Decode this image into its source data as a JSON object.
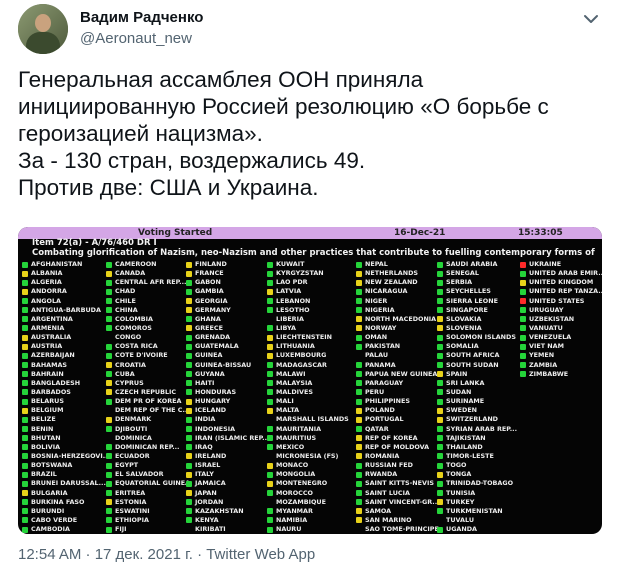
{
  "author": {
    "name": "Вадим Радченко",
    "handle": "@Aeronaut_new"
  },
  "tweet_lines": [
    "Генеральная ассамблея ООН приняла",
    "инициированную Россией резолюцию «О борьбе с",
    "героизацией нацизма».",
    "За - 130 стран, воздержались 49.",
    "Против две: США и Украина."
  ],
  "board": {
    "header_status": "Voting Started",
    "header_date": "16-Dec-21",
    "header_time": "15:33:05",
    "item": "Item 72(a) - A/76/460 DR I",
    "description": "Combating glorification of Nazism, neo-Nazism and other practices that contribute to fuelling contemporary forms of",
    "columns": [
      [
        {
          "c": "AFGHANISTAN",
          "v": "Y"
        },
        {
          "c": "ALBANIA",
          "v": "A"
        },
        {
          "c": "ALGERIA",
          "v": "Y"
        },
        {
          "c": "ANDORRA",
          "v": "A"
        },
        {
          "c": "ANGOLA",
          "v": "Y"
        },
        {
          "c": "ANTIGUA-BARBUDA",
          "v": "Y"
        },
        {
          "c": "ARGENTINA",
          "v": "Y"
        },
        {
          "c": "ARMENIA",
          "v": "Y"
        },
        {
          "c": "AUSTRALIA",
          "v": "A"
        },
        {
          "c": "AUSTRIA",
          "v": "A"
        },
        {
          "c": "AZERBAIJAN",
          "v": "Y"
        },
        {
          "c": "BAHAMAS",
          "v": "Y"
        },
        {
          "c": "BAHRAIN",
          "v": "Y"
        },
        {
          "c": "BANGLADESH",
          "v": "Y"
        },
        {
          "c": "BARBADOS",
          "v": "Y"
        },
        {
          "c": "BELARUS",
          "v": "Y"
        },
        {
          "c": "BELGIUM",
          "v": "A"
        },
        {
          "c": "BELIZE",
          "v": "Y"
        },
        {
          "c": "BENIN",
          "v": "Y"
        },
        {
          "c": "BHUTAN",
          "v": "Y"
        },
        {
          "c": "BOLIVIA",
          "v": "Y"
        },
        {
          "c": "BOSNIA-HERZEGOVI...",
          "v": "Y"
        },
        {
          "c": "BOTSWANA",
          "v": "Y"
        },
        {
          "c": "BRAZIL",
          "v": "Y"
        },
        {
          "c": "BRUNEI DARUSSAL...",
          "v": "Y"
        },
        {
          "c": "BULGARIA",
          "v": "A"
        },
        {
          "c": "BURKINA FASO",
          "v": "Y"
        },
        {
          "c": "BURUNDI",
          "v": "Y"
        },
        {
          "c": "CABO VERDE",
          "v": "Y"
        },
        {
          "c": "CAMBODIA",
          "v": "Y"
        }
      ],
      [
        {
          "c": "CAMEROON",
          "v": "Y"
        },
        {
          "c": "CANADA",
          "v": "A"
        },
        {
          "c": "CENTRAL AFR REP...",
          "v": "Y"
        },
        {
          "c": "CHAD",
          "v": "Y"
        },
        {
          "c": "CHILE",
          "v": "Y"
        },
        {
          "c": "CHINA",
          "v": "Y"
        },
        {
          "c": "COLOMBIA",
          "v": "Y"
        },
        {
          "c": "COMOROS",
          "v": "Y"
        },
        {
          "c": "CONGO",
          "v": "X"
        },
        {
          "c": "COSTA RICA",
          "v": "Y"
        },
        {
          "c": "COTE D'IVOIRE",
          "v": "Y"
        },
        {
          "c": "CROATIA",
          "v": "A"
        },
        {
          "c": "CUBA",
          "v": "Y"
        },
        {
          "c": "CYPRUS",
          "v": "A"
        },
        {
          "c": "CZECH REPUBLIC",
          "v": "A"
        },
        {
          "c": "DEM PR OF KOREA",
          "v": "Y"
        },
        {
          "c": "DEM REP OF THE C...",
          "v": "X"
        },
        {
          "c": "DENMARK",
          "v": "A"
        },
        {
          "c": "DJIBOUTI",
          "v": "Y"
        },
        {
          "c": "DOMINICA",
          "v": "X"
        },
        {
          "c": "DOMINICAN REP...",
          "v": "Y"
        },
        {
          "c": "ECUADOR",
          "v": "Y"
        },
        {
          "c": "EGYPT",
          "v": "Y"
        },
        {
          "c": "EL SALVADOR",
          "v": "Y"
        },
        {
          "c": "EQUATORIAL GUINEA",
          "v": "Y"
        },
        {
          "c": "ERITREA",
          "v": "Y"
        },
        {
          "c": "ESTONIA",
          "v": "A"
        },
        {
          "c": "ESWATINI",
          "v": "Y"
        },
        {
          "c": "ETHIOPIA",
          "v": "Y"
        },
        {
          "c": "FIJI",
          "v": "Y"
        }
      ],
      [
        {
          "c": "FINLAND",
          "v": "A"
        },
        {
          "c": "FRANCE",
          "v": "A"
        },
        {
          "c": "GABON",
          "v": "Y"
        },
        {
          "c": "GAMBIA",
          "v": "Y"
        },
        {
          "c": "GEORGIA",
          "v": "A"
        },
        {
          "c": "GERMANY",
          "v": "A"
        },
        {
          "c": "GHANA",
          "v": "Y"
        },
        {
          "c": "GREECE",
          "v": "A"
        },
        {
          "c": "GRENADA",
          "v": "Y"
        },
        {
          "c": "GUATEMALA",
          "v": "Y"
        },
        {
          "c": "GUINEA",
          "v": "Y"
        },
        {
          "c": "GUINEA-BISSAU",
          "v": "Y"
        },
        {
          "c": "GUYANA",
          "v": "Y"
        },
        {
          "c": "HAITI",
          "v": "Y"
        },
        {
          "c": "HONDURAS",
          "v": "Y"
        },
        {
          "c": "HUNGARY",
          "v": "A"
        },
        {
          "c": "ICELAND",
          "v": "A"
        },
        {
          "c": "INDIA",
          "v": "Y"
        },
        {
          "c": "INDONESIA",
          "v": "Y"
        },
        {
          "c": "IRAN (ISLAMIC REP...",
          "v": "Y"
        },
        {
          "c": "IRAQ",
          "v": "Y"
        },
        {
          "c": "IRELAND",
          "v": "A"
        },
        {
          "c": "ISRAEL",
          "v": "Y"
        },
        {
          "c": "ITALY",
          "v": "A"
        },
        {
          "c": "JAMAICA",
          "v": "Y"
        },
        {
          "c": "JAPAN",
          "v": "A"
        },
        {
          "c": "JORDAN",
          "v": "Y"
        },
        {
          "c": "KAZAKHSTAN",
          "v": "Y"
        },
        {
          "c": "KENYA",
          "v": "Y"
        },
        {
          "c": "KIRIBATI",
          "v": "X"
        }
      ],
      [
        {
          "c": "KUWAIT",
          "v": "Y"
        },
        {
          "c": "KYRGYZSTAN",
          "v": "Y"
        },
        {
          "c": "LAO PDR",
          "v": "Y"
        },
        {
          "c": "LATVIA",
          "v": "A"
        },
        {
          "c": "LEBANON",
          "v": "Y"
        },
        {
          "c": "LESOTHO",
          "v": "Y"
        },
        {
          "c": "LIBERIA",
          "v": "X"
        },
        {
          "c": "LIBYA",
          "v": "Y"
        },
        {
          "c": "LIECHTENSTEIN",
          "v": "A"
        },
        {
          "c": "LITHUANIA",
          "v": "A"
        },
        {
          "c": "LUXEMBOURG",
          "v": "A"
        },
        {
          "c": "MADAGASCAR",
          "v": "Y"
        },
        {
          "c": "MALAWI",
          "v": "Y"
        },
        {
          "c": "MALAYSIA",
          "v": "Y"
        },
        {
          "c": "MALDIVES",
          "v": "Y"
        },
        {
          "c": "MALI",
          "v": "Y"
        },
        {
          "c": "MALTA",
          "v": "A"
        },
        {
          "c": "MARSHALL ISLANDS",
          "v": "X"
        },
        {
          "c": "MAURITANIA",
          "v": "Y"
        },
        {
          "c": "MAURITIUS",
          "v": "Y"
        },
        {
          "c": "MEXICO",
          "v": "Y"
        },
        {
          "c": "MICRONESIA (FS)",
          "v": "X"
        },
        {
          "c": "MONACO",
          "v": "A"
        },
        {
          "c": "MONGOLIA",
          "v": "Y"
        },
        {
          "c": "MONTENEGRO",
          "v": "A"
        },
        {
          "c": "MOROCCO",
          "v": "Y"
        },
        {
          "c": "MOZAMBIQUE",
          "v": "X"
        },
        {
          "c": "MYANMAR",
          "v": "Y"
        },
        {
          "c": "NAMIBIA",
          "v": "Y"
        },
        {
          "c": "NAURU",
          "v": "Y"
        }
      ],
      [
        {
          "c": "NEPAL",
          "v": "Y"
        },
        {
          "c": "NETHERLANDS",
          "v": "A"
        },
        {
          "c": "NEW ZEALAND",
          "v": "A"
        },
        {
          "c": "NICARAGUA",
          "v": "Y"
        },
        {
          "c": "NIGER",
          "v": "Y"
        },
        {
          "c": "NIGERIA",
          "v": "Y"
        },
        {
          "c": "NORTH MACEDONIA",
          "v": "A"
        },
        {
          "c": "NORWAY",
          "v": "A"
        },
        {
          "c": "OMAN",
          "v": "Y"
        },
        {
          "c": "PAKISTAN",
          "v": "Y"
        },
        {
          "c": "PALAU",
          "v": "X"
        },
        {
          "c": "PANAMA",
          "v": "Y"
        },
        {
          "c": "PAPUA NEW GUINEA",
          "v": "Y"
        },
        {
          "c": "PARAGUAY",
          "v": "Y"
        },
        {
          "c": "PERU",
          "v": "Y"
        },
        {
          "c": "PHILIPPINES",
          "v": "Y"
        },
        {
          "c": "POLAND",
          "v": "A"
        },
        {
          "c": "PORTUGAL",
          "v": "A"
        },
        {
          "c": "QATAR",
          "v": "Y"
        },
        {
          "c": "REP OF KOREA",
          "v": "A"
        },
        {
          "c": "REP OF MOLDOVA",
          "v": "A"
        },
        {
          "c": "ROMANIA",
          "v": "A"
        },
        {
          "c": "RUSSIAN FED",
          "v": "Y"
        },
        {
          "c": "RWANDA",
          "v": "Y"
        },
        {
          "c": "SAINT KITTS-NEVIS",
          "v": "Y"
        },
        {
          "c": "SAINT LUCIA",
          "v": "Y"
        },
        {
          "c": "SAINT VINCENT-GR...",
          "v": "Y"
        },
        {
          "c": "SAMOA",
          "v": "A"
        },
        {
          "c": "SAN MARINO",
          "v": "A"
        },
        {
          "c": "SAO TOME-PRINCIPE",
          "v": "X"
        }
      ],
      [
        {
          "c": "SAUDI ARABIA",
          "v": "Y"
        },
        {
          "c": "SENEGAL",
          "v": "Y"
        },
        {
          "c": "SERBIA",
          "v": "Y"
        },
        {
          "c": "SEYCHELLES",
          "v": "Y"
        },
        {
          "c": "SIERRA LEONE",
          "v": "Y"
        },
        {
          "c": "SINGAPORE",
          "v": "Y"
        },
        {
          "c": "SLOVAKIA",
          "v": "A"
        },
        {
          "c": "SLOVENIA",
          "v": "A"
        },
        {
          "c": "SOLOMON ISLANDS",
          "v": "Y"
        },
        {
          "c": "SOMALIA",
          "v": "Y"
        },
        {
          "c": "SOUTH AFRICA",
          "v": "Y"
        },
        {
          "c": "SOUTH SUDAN",
          "v": "Y"
        },
        {
          "c": "SPAIN",
          "v": "A"
        },
        {
          "c": "SRI LANKA",
          "v": "Y"
        },
        {
          "c": "SUDAN",
          "v": "Y"
        },
        {
          "c": "SURINAME",
          "v": "Y"
        },
        {
          "c": "SWEDEN",
          "v": "A"
        },
        {
          "c": "SWITZERLAND",
          "v": "A"
        },
        {
          "c": "SYRIAN ARAB REP...",
          "v": "Y"
        },
        {
          "c": "TAJIKISTAN",
          "v": "Y"
        },
        {
          "c": "THAILAND",
          "v": "Y"
        },
        {
          "c": "TIMOR-LESTE",
          "v": "Y"
        },
        {
          "c": "TOGO",
          "v": "Y"
        },
        {
          "c": "TONGA",
          "v": "A"
        },
        {
          "c": "TRINIDAD-TOBAGO",
          "v": "Y"
        },
        {
          "c": "TUNISIA",
          "v": "Y"
        },
        {
          "c": "TURKEY",
          "v": "A"
        },
        {
          "c": "TURKMENISTAN",
          "v": "Y"
        },
        {
          "c": "TUVALU",
          "v": "X"
        },
        {
          "c": "UGANDA",
          "v": "Y"
        }
      ],
      [
        {
          "c": "UKRAINE",
          "v": "N"
        },
        {
          "c": "UNITED ARAB EMIR...",
          "v": "Y"
        },
        {
          "c": "UNITED KINGDOM",
          "v": "A"
        },
        {
          "c": "UNITED REP TANZA...",
          "v": "Y"
        },
        {
          "c": "UNITED STATES",
          "v": "N"
        },
        {
          "c": "URUGUAY",
          "v": "Y"
        },
        {
          "c": "UZBEKISTAN",
          "v": "Y"
        },
        {
          "c": "VANUATU",
          "v": "Y"
        },
        {
          "c": "VENEZUELA",
          "v": "Y"
        },
        {
          "c": "VIET NAM",
          "v": "Y"
        },
        {
          "c": "YEMEN",
          "v": "Y"
        },
        {
          "c": "ZAMBIA",
          "v": "Y"
        },
        {
          "c": "ZIMBABWE",
          "v": "Y"
        }
      ]
    ]
  },
  "footer": {
    "timestamp": "12:54 AM · 17 дек. 2021 г. · Twitter Web App"
  },
  "colors": {
    "yes": "#25d43a",
    "no": "#ff2a2a",
    "abstain": "#e8d21a",
    "board_bar": "#d4a6e6"
  }
}
